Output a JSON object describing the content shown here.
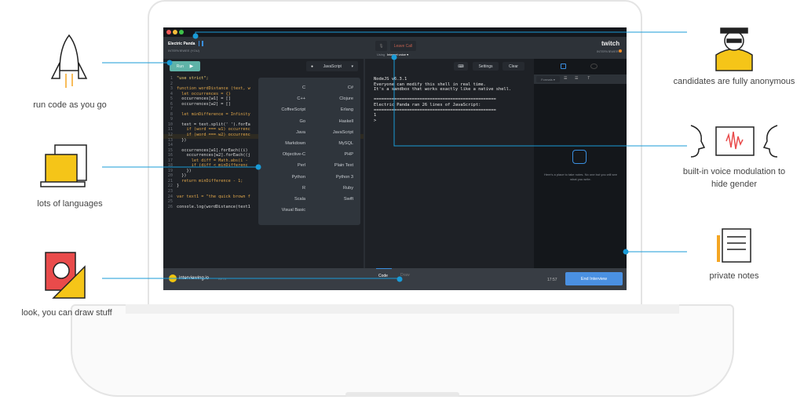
{
  "window": {
    "user_name": "Electric Panda",
    "user_role": "INTERVIEWEE (YOU)",
    "interviewer_brand": "twitch",
    "interviewer_role": "INTERVIEWER"
  },
  "call": {
    "leave_label": "Leave Call",
    "using_label": "Using",
    "voice_label": "Internet voice ▾"
  },
  "editor": {
    "run_label": "Run",
    "language": "JavaScript",
    "lines": [
      "\"use strict\";",
      "",
      "function wordDistance (text, w",
      "  let occurrences = {}",
      "  occurrences[w1] = []",
      "  occurrences[w2] = []",
      "",
      "  let minDifference = Infinity",
      "",
      "  text = text.split(' ').forEa",
      "    if (word === w1) occurrenc",
      "    if (word === w2) occurrenc",
      "  })",
      "",
      "  occurrences[w1].forEach((i)",
      "    occurrences[w2].forEach((j",
      "      let diff = Math.abs(i -",
      "      if (diff < minDifferenc",
      "    })",
      "  })",
      "  return minDifference - 1;",
      "}",
      "",
      "var text1 = \"the quick brown f",
      "",
      "console.log(wordDistance(text1"
    ]
  },
  "languages": {
    "left": [
      "C",
      "C++",
      "CoffeeScript",
      "Go",
      "Java",
      "Markdown",
      "Objective-C",
      "Perl",
      "Python",
      "R",
      "Scala",
      "Visual Basic"
    ],
    "right": [
      "C#",
      "Clojure",
      "Erlang",
      "Haskell",
      "JavaScript",
      "MySQL",
      "PHP",
      "Plain Text",
      "Python 3",
      "Ruby",
      "Swift"
    ]
  },
  "terminal": {
    "settings_label": "Settings",
    "clear_label": "Clear",
    "output": "NodeJS v6.3.1\nEveryone can modify this shell in real time.\nIt's a sandbox that works exactly like a native shell.\n\n================================================\nElectric Panda ran 26 lines of JavaScript:\n================================================\n1\n>"
  },
  "notes": {
    "formats_label": "Formats ▾",
    "placeholder": "Here's a place to take notes. No one but you will see what you write."
  },
  "footer": {
    "brand": "interviewing.io",
    "beta": "BETA",
    "tab_code": "Code",
    "tab_draw": "Draw",
    "timer": "17:57",
    "end_label": "End Interview"
  },
  "callouts": {
    "run": "run code as you go",
    "languages": "lots of languages",
    "draw": "look, you can draw stuff",
    "anonymous": "candidates are fully anonymous",
    "voice": "built-in voice modulation to hide gender",
    "notes": "private notes"
  },
  "colors": {
    "accent": "#1a9bd7",
    "run": "#5fb3a8",
    "end": "#4a90e2"
  }
}
